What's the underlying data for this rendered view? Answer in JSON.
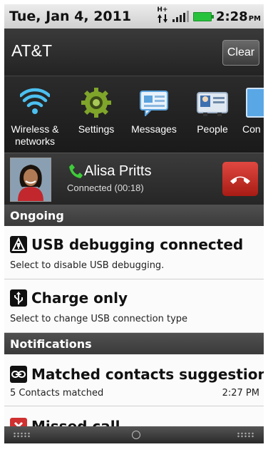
{
  "status_bar": {
    "date": "Tue, Jan 4, 2011",
    "network": "H+",
    "time": "2:28",
    "ampm": "PM"
  },
  "carrier": {
    "name": "AT&T",
    "clear_label": "Clear"
  },
  "quick_settings": [
    {
      "label": "Wireless & networks",
      "icon": "wifi-icon"
    },
    {
      "label": "Settings",
      "icon": "gear-icon"
    },
    {
      "label": "Messages",
      "icon": "messages-icon"
    },
    {
      "label": "People",
      "icon": "people-icon"
    },
    {
      "label": "Con",
      "icon": "connect-icon"
    }
  ],
  "call": {
    "name": "Alisa Pritts",
    "status": "Connected (00:18)"
  },
  "sections": {
    "ongoing": "Ongoing",
    "notifications": "Notifications"
  },
  "ongoing": [
    {
      "title": "USB debugging connected",
      "subtitle": "Select to disable USB debugging.",
      "icon": "android-debug-icon"
    },
    {
      "title": "Charge only",
      "subtitle": "Select to change USB connection type",
      "icon": "usb-icon"
    }
  ],
  "notifications": [
    {
      "title": "Matched contacts suggestion",
      "subtitle": "5 Contacts matched",
      "time": "2:27 PM",
      "icon": "link-icon"
    },
    {
      "title": "Missed call",
      "icon": "missed-call-icon"
    }
  ],
  "colors": {
    "battery": "#27c23b",
    "end_call": "#c8261d",
    "phone_green": "#3ecb3a",
    "wifi_blue": "#4cc0f0"
  }
}
